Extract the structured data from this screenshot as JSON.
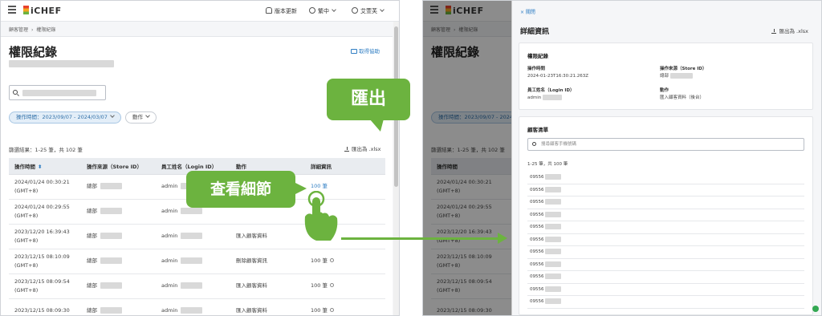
{
  "app": {
    "logo_text": "iCHEF"
  },
  "topbar": {
    "version_update": "版本更新",
    "language": "繁中",
    "user": "艾萱芙"
  },
  "breadcrumb": {
    "parent": "顧客管理",
    "current": "權限紀錄"
  },
  "page": {
    "title": "權限紀錄",
    "help": "取得協助"
  },
  "filters": {
    "time_chip": "操作時間：2023/09/07 - 2024/03/07",
    "action_chip": "動作"
  },
  "results_text": "篩選結果：1-25 筆，共 102 筆",
  "export_label": "匯出為 .xlsx",
  "table": {
    "columns": [
      "操作時間",
      "操作來源（Store ID）",
      "員工姓名（Login ID）",
      "動作",
      "詳細資訊"
    ],
    "rows": [
      {
        "time": "2024/01/24 00:30:21",
        "tz": "(GMT+8)",
        "source": "總部",
        "staff": "admin",
        "action": "",
        "detail": "100 筆"
      },
      {
        "time": "2024/01/24 00:29:55",
        "tz": "(GMT+8)",
        "source": "總部",
        "staff": "admin",
        "action": "",
        "detail": ""
      },
      {
        "time": "2023/12/20 16:39:43",
        "tz": "(GMT+8)",
        "source": "總部",
        "staff": "admin",
        "action": "匯入顧客資料",
        "detail": "0"
      },
      {
        "time": "2023/12/15 08:10:09",
        "tz": "(GMT+8)",
        "source": "總部",
        "staff": "admin",
        "action": "刪除顧客資訊",
        "detail": "100 筆"
      },
      {
        "time": "2023/12/15 08:09:54",
        "tz": "(GMT+8)",
        "source": "總部",
        "staff": "admin",
        "action": "匯入顧客資料",
        "detail": "100 筆"
      },
      {
        "time": "2023/12/15 08:09:30",
        "tz": "",
        "source": "總部",
        "staff": "admin",
        "action": "匯入顧客資料",
        "detail": "100 筆"
      }
    ]
  },
  "drawer": {
    "close": "× 關閉",
    "title": "詳細資訊",
    "export_label": "匯出為 .xlsx",
    "record": {
      "heading": "權限紀錄",
      "time_label": "操作時間",
      "time_value": "2024-01-23T16:30:21.263Z",
      "source_label": "操作來源（Store ID）",
      "source_value": "總部",
      "staff_label": "員工姓名（Login ID）",
      "staff_value": "admin",
      "action_label": "動作",
      "action_value": "匯入顧客資料（後台）"
    },
    "customers": {
      "heading": "顧客清單",
      "search_placeholder": "搜尋顧客手機號碼",
      "count": "1-25 筆，共 100 筆",
      "phones": [
        "09556",
        "09556",
        "09556",
        "09556",
        "09556",
        "09556",
        "09556",
        "09556",
        "09556",
        "09556",
        "09556"
      ]
    }
  },
  "callouts": {
    "export": "匯出",
    "detail": "查看細節"
  },
  "colors": {
    "accent": "#2f7ec3",
    "callout_green": "#6cb33f"
  }
}
